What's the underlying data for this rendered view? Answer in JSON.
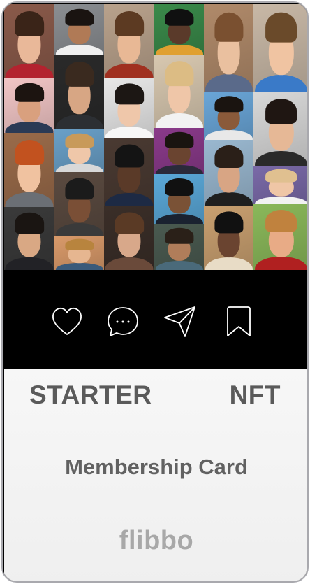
{
  "card": {
    "tier_label": "STARTER",
    "kind_label": "NFT",
    "title": "Membership Card",
    "brand": "flibbo"
  },
  "actions": [
    {
      "name": "like",
      "icon": "heart-icon"
    },
    {
      "name": "comment",
      "icon": "comment-bubble-icon"
    },
    {
      "name": "share",
      "icon": "paper-plane-icon"
    },
    {
      "name": "save",
      "icon": "bookmark-icon"
    }
  ],
  "colors": {
    "action_bar_bg": "#000000",
    "panel_bg": "#f2f2f2",
    "label_text": "#5a5a5a",
    "brand_text": "#a8a8a8",
    "border": "#a9a9ae"
  }
}
